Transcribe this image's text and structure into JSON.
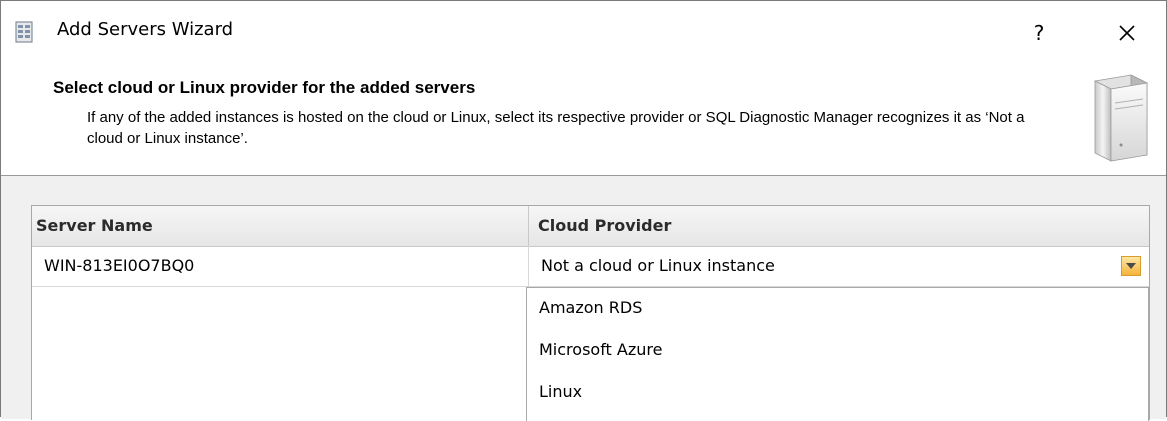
{
  "window": {
    "title": "Add Servers Wizard",
    "help_label": "?"
  },
  "header": {
    "title": "Select cloud or Linux provider for the added servers",
    "description": "If any of the added instances is hosted on the cloud or Linux, select its respective provider or SQL Diagnostic Manager recognizes it as ‘Not a cloud or Linux instance’."
  },
  "grid": {
    "columns": [
      "Server Name",
      "Cloud Provider"
    ],
    "rows": [
      {
        "server_name": "WIN-813EI0O7BQ0",
        "cloud_provider": "Not a cloud or Linux instance"
      }
    ]
  },
  "dropdown": {
    "options": [
      "Amazon RDS",
      "Microsoft Azure",
      "Linux"
    ]
  },
  "colors": {
    "accent": "#f6b43a",
    "body_background": "#f0f0f0"
  }
}
